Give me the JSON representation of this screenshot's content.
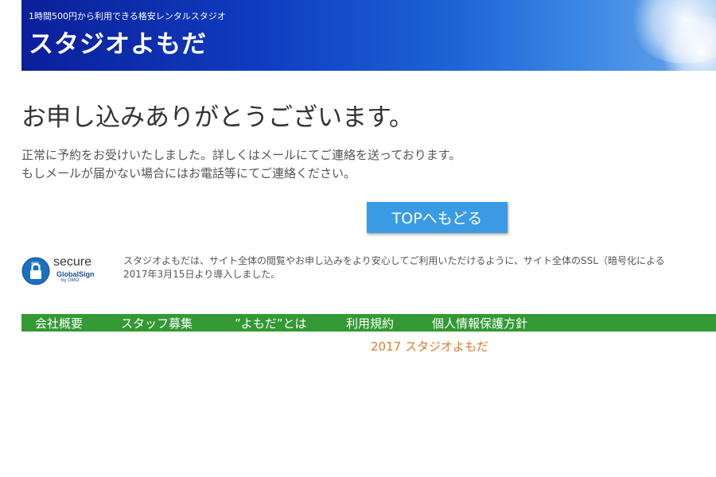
{
  "header": {
    "tagline": "1時間500円から利用できる格安レンタルスタジオ",
    "site_title": "スタジオよもだ"
  },
  "main": {
    "heading": "お申し込みありがとうございます。",
    "message_line1": "正常に予約をお受けいたしました。詳しくはメールにてご連絡を送っております。",
    "message_line2": "もしメールが届かない場合にはお電話等にてご連絡ください。",
    "top_button_label": "TOPへもどる"
  },
  "ssl": {
    "badge_ssl": "SSL",
    "badge_secure": "secure",
    "badge_globalsign": "GlobalSign",
    "badge_by": "by GMO",
    "text_line1": "スタジオよもだは、サイト全体の閲覧やお申し込みをより安心してご利用いただけるように、サイト全体のSSL（暗号化による",
    "text_line2": "2017年3月15日より導入しました。"
  },
  "footer": {
    "nav": [
      {
        "label": "会社概要"
      },
      {
        "label": "スタッフ募集"
      },
      {
        "label": "”よもだ”とは"
      },
      {
        "label": "利用規約"
      },
      {
        "label": "個人情報保護方針"
      }
    ],
    "copyright": "2017 スタジオよもだ"
  },
  "colors": {
    "header_blue": "#0f3dc0",
    "button_blue": "#3a9be4",
    "footer_green": "#339933",
    "copyright_orange": "#e07a2b"
  }
}
